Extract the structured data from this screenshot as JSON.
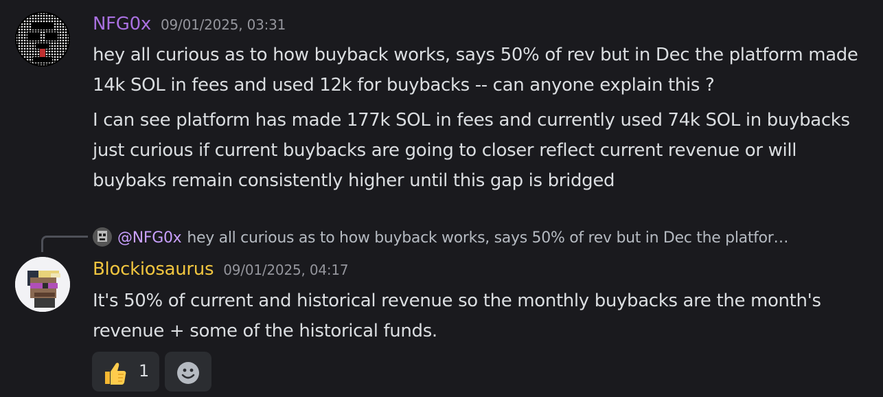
{
  "messages": [
    {
      "username": "NFG0x",
      "username_color": "#a970e0",
      "timestamp": "09/01/2025, 03:31",
      "paragraphs": [
        "hey all curious as to how buyback works, says 50% of rev but in Dec the platform made 14k SOL in fees and used 12k for buybacks -- can anyone explain this ?",
        "I can see platform has made 177k SOL in fees and currently used 74k SOL in buybacks just curious if current buybacks are going to closer reflect current revenue or will buybaks remain consistently higher until this gap is bridged"
      ]
    },
    {
      "reply_to": {
        "mention": "@NFG0x",
        "preview": "hey all curious as to how buyback works, says 50% of rev but in Dec the platfor…"
      },
      "username": "Blockiosaurus",
      "username_color": "#f0c53f",
      "timestamp": "09/01/2025, 04:17",
      "paragraphs": [
        "It's 50% of current and historical revenue so the monthly buybacks are the month's revenue + some of the historical funds."
      ],
      "reactions": [
        {
          "emoji": "thumbs-up-emoji",
          "count": "1"
        }
      ],
      "add_reaction_icon": "smiley-add-reaction-icon"
    }
  ]
}
